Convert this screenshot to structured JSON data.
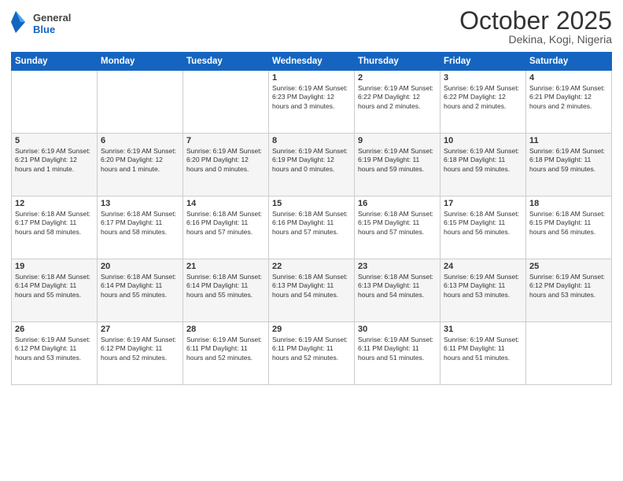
{
  "header": {
    "logo_general": "General",
    "logo_blue": "Blue",
    "month": "October 2025",
    "location": "Dekina, Kogi, Nigeria"
  },
  "days_of_week": [
    "Sunday",
    "Monday",
    "Tuesday",
    "Wednesday",
    "Thursday",
    "Friday",
    "Saturday"
  ],
  "weeks": [
    [
      {
        "day": "",
        "info": ""
      },
      {
        "day": "",
        "info": ""
      },
      {
        "day": "",
        "info": ""
      },
      {
        "day": "1",
        "info": "Sunrise: 6:19 AM\nSunset: 6:23 PM\nDaylight: 12 hours and 3 minutes."
      },
      {
        "day": "2",
        "info": "Sunrise: 6:19 AM\nSunset: 6:22 PM\nDaylight: 12 hours and 2 minutes."
      },
      {
        "day": "3",
        "info": "Sunrise: 6:19 AM\nSunset: 6:22 PM\nDaylight: 12 hours and 2 minutes."
      },
      {
        "day": "4",
        "info": "Sunrise: 6:19 AM\nSunset: 6:21 PM\nDaylight: 12 hours and 2 minutes."
      }
    ],
    [
      {
        "day": "5",
        "info": "Sunrise: 6:19 AM\nSunset: 6:21 PM\nDaylight: 12 hours and 1 minute."
      },
      {
        "day": "6",
        "info": "Sunrise: 6:19 AM\nSunset: 6:20 PM\nDaylight: 12 hours and 1 minute."
      },
      {
        "day": "7",
        "info": "Sunrise: 6:19 AM\nSunset: 6:20 PM\nDaylight: 12 hours and 0 minutes."
      },
      {
        "day": "8",
        "info": "Sunrise: 6:19 AM\nSunset: 6:19 PM\nDaylight: 12 hours and 0 minutes."
      },
      {
        "day": "9",
        "info": "Sunrise: 6:19 AM\nSunset: 6:19 PM\nDaylight: 11 hours and 59 minutes."
      },
      {
        "day": "10",
        "info": "Sunrise: 6:19 AM\nSunset: 6:18 PM\nDaylight: 11 hours and 59 minutes."
      },
      {
        "day": "11",
        "info": "Sunrise: 6:19 AM\nSunset: 6:18 PM\nDaylight: 11 hours and 59 minutes."
      }
    ],
    [
      {
        "day": "12",
        "info": "Sunrise: 6:18 AM\nSunset: 6:17 PM\nDaylight: 11 hours and 58 minutes."
      },
      {
        "day": "13",
        "info": "Sunrise: 6:18 AM\nSunset: 6:17 PM\nDaylight: 11 hours and 58 minutes."
      },
      {
        "day": "14",
        "info": "Sunrise: 6:18 AM\nSunset: 6:16 PM\nDaylight: 11 hours and 57 minutes."
      },
      {
        "day": "15",
        "info": "Sunrise: 6:18 AM\nSunset: 6:16 PM\nDaylight: 11 hours and 57 minutes."
      },
      {
        "day": "16",
        "info": "Sunrise: 6:18 AM\nSunset: 6:15 PM\nDaylight: 11 hours and 57 minutes."
      },
      {
        "day": "17",
        "info": "Sunrise: 6:18 AM\nSunset: 6:15 PM\nDaylight: 11 hours and 56 minutes."
      },
      {
        "day": "18",
        "info": "Sunrise: 6:18 AM\nSunset: 6:15 PM\nDaylight: 11 hours and 56 minutes."
      }
    ],
    [
      {
        "day": "19",
        "info": "Sunrise: 6:18 AM\nSunset: 6:14 PM\nDaylight: 11 hours and 55 minutes."
      },
      {
        "day": "20",
        "info": "Sunrise: 6:18 AM\nSunset: 6:14 PM\nDaylight: 11 hours and 55 minutes."
      },
      {
        "day": "21",
        "info": "Sunrise: 6:18 AM\nSunset: 6:14 PM\nDaylight: 11 hours and 55 minutes."
      },
      {
        "day": "22",
        "info": "Sunrise: 6:18 AM\nSunset: 6:13 PM\nDaylight: 11 hours and 54 minutes."
      },
      {
        "day": "23",
        "info": "Sunrise: 6:18 AM\nSunset: 6:13 PM\nDaylight: 11 hours and 54 minutes."
      },
      {
        "day": "24",
        "info": "Sunrise: 6:19 AM\nSunset: 6:13 PM\nDaylight: 11 hours and 53 minutes."
      },
      {
        "day": "25",
        "info": "Sunrise: 6:19 AM\nSunset: 6:12 PM\nDaylight: 11 hours and 53 minutes."
      }
    ],
    [
      {
        "day": "26",
        "info": "Sunrise: 6:19 AM\nSunset: 6:12 PM\nDaylight: 11 hours and 53 minutes."
      },
      {
        "day": "27",
        "info": "Sunrise: 6:19 AM\nSunset: 6:12 PM\nDaylight: 11 hours and 52 minutes."
      },
      {
        "day": "28",
        "info": "Sunrise: 6:19 AM\nSunset: 6:11 PM\nDaylight: 11 hours and 52 minutes."
      },
      {
        "day": "29",
        "info": "Sunrise: 6:19 AM\nSunset: 6:11 PM\nDaylight: 11 hours and 52 minutes."
      },
      {
        "day": "30",
        "info": "Sunrise: 6:19 AM\nSunset: 6:11 PM\nDaylight: 11 hours and 51 minutes."
      },
      {
        "day": "31",
        "info": "Sunrise: 6:19 AM\nSunset: 6:11 PM\nDaylight: 11 hours and 51 minutes."
      },
      {
        "day": "",
        "info": ""
      }
    ]
  ]
}
